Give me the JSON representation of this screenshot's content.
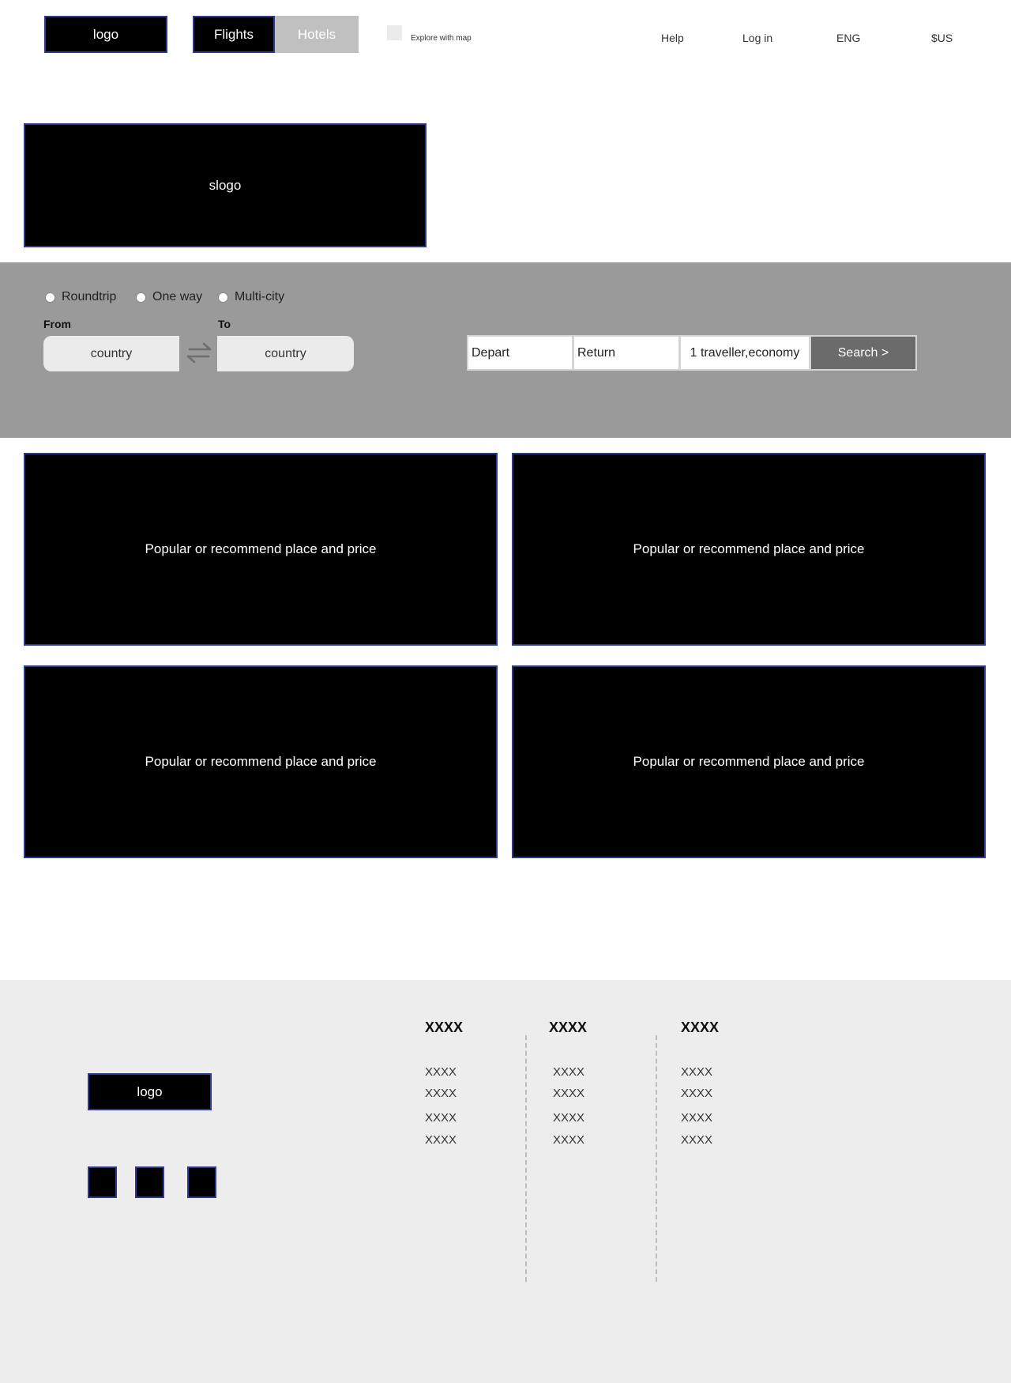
{
  "header": {
    "logo": "logo",
    "tabs": [
      "Flights",
      "Hotels"
    ],
    "explore_label": "Explore with map",
    "links": {
      "help": "Help",
      "login": "Log in",
      "language": "ENG",
      "currency": "$US"
    }
  },
  "hero": {
    "slogan": "slogo"
  },
  "search": {
    "trip_types": [
      "Roundtrip",
      "One way",
      "Multi-city"
    ],
    "from_label": "From",
    "to_label": "To",
    "from_value": "country",
    "to_value": "country",
    "depart": "Depart",
    "return": "Return",
    "travellers": "1 traveller,economy",
    "search_button": "Search >"
  },
  "cards": [
    "Popular or recommend place and price",
    "Popular or recommend place and price",
    "Popular or recommend place and price",
    "Popular or recommend place and price"
  ],
  "footer": {
    "logo": "logo",
    "columns": [
      {
        "heading": "XXXX",
        "items": [
          "XXXX",
          "XXXX",
          "XXXX",
          "XXXX"
        ]
      },
      {
        "heading": "XXXX",
        "items": [
          "XXXX",
          "XXXX",
          "XXXX",
          "XXXX"
        ]
      },
      {
        "heading": "XXXX",
        "items": [
          "XXXX",
          "XXXX",
          "XXXX",
          "XXXX"
        ]
      }
    ]
  },
  "colors": {
    "accent_border": "#2b3a8f",
    "search_band": "#9a9a9a",
    "search_button": "#6b6b6b",
    "footer_bg": "#ededed"
  }
}
